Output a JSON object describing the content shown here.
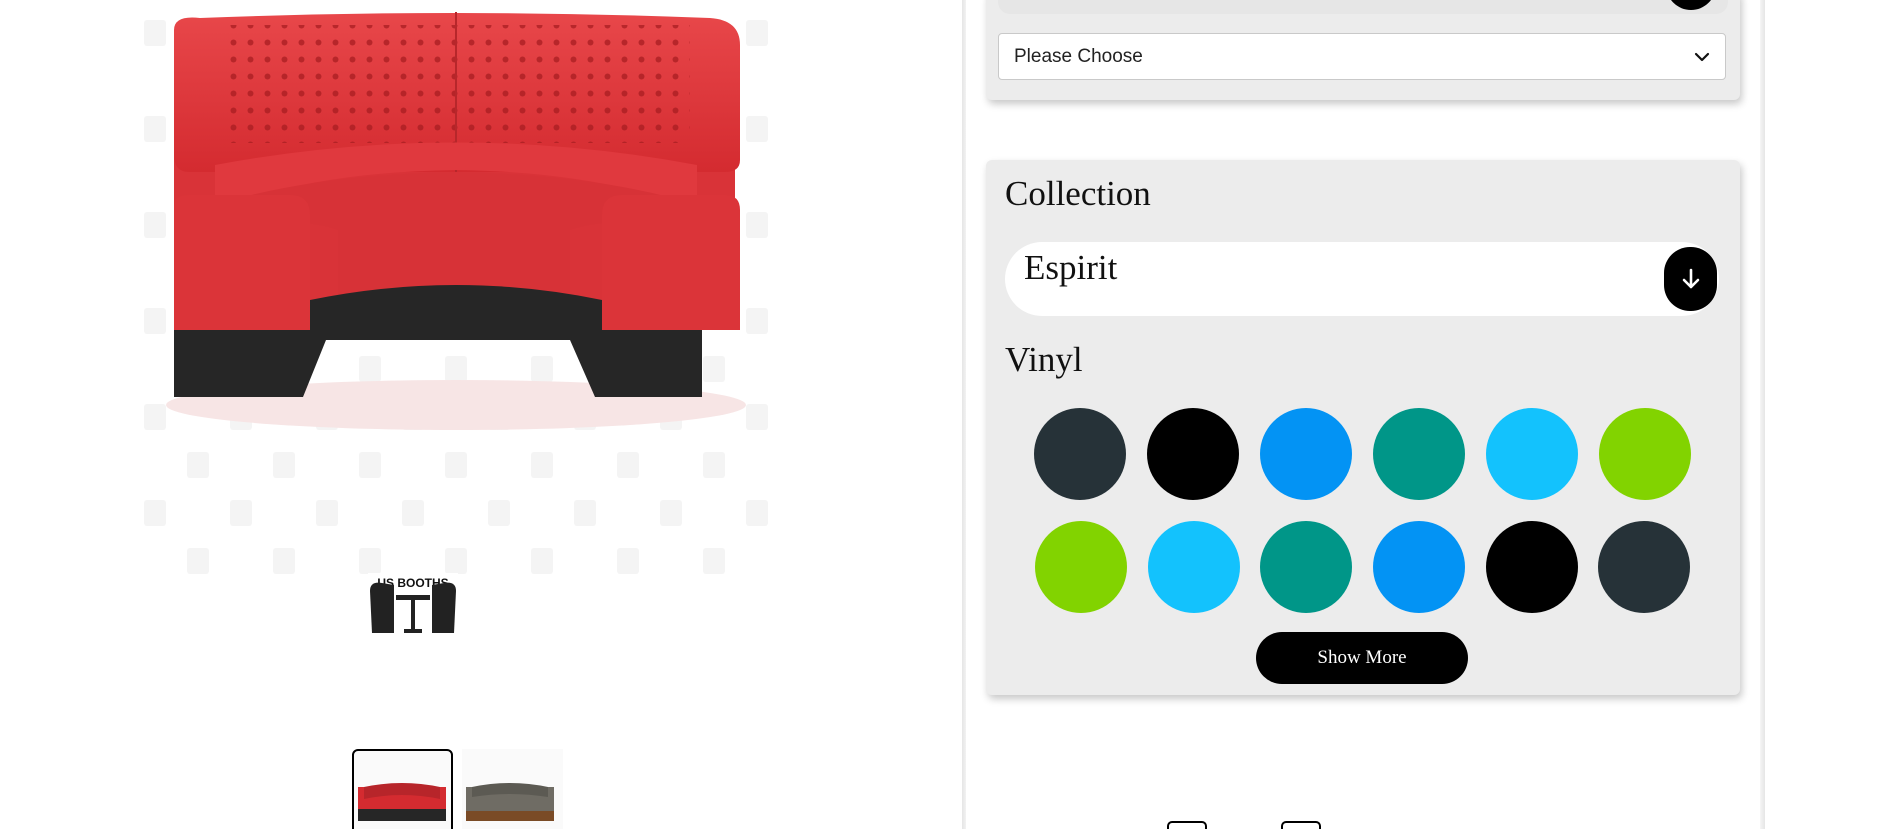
{
  "product": {
    "main_image": "red tufted booth image",
    "logo_text": "US BOOTHS",
    "thumbnails": [
      "red tufted booth",
      "gray booth with wood base"
    ]
  },
  "config": {
    "top_select": {
      "value": "Please Choose"
    },
    "collection": {
      "title": "Collection",
      "value": "Espirit",
      "button_icon": "arrow-down-icon"
    },
    "vinyl": {
      "title": "Vinyl",
      "swatches": [
        "#263238",
        "#000000",
        "#0393f4",
        "#009688",
        "#13c2fd",
        "#82d300",
        "#82d300",
        "#13c2fd",
        "#009688",
        "#0393f4",
        "#000000",
        "#263238"
      ]
    },
    "show_more_label": "Show More"
  }
}
